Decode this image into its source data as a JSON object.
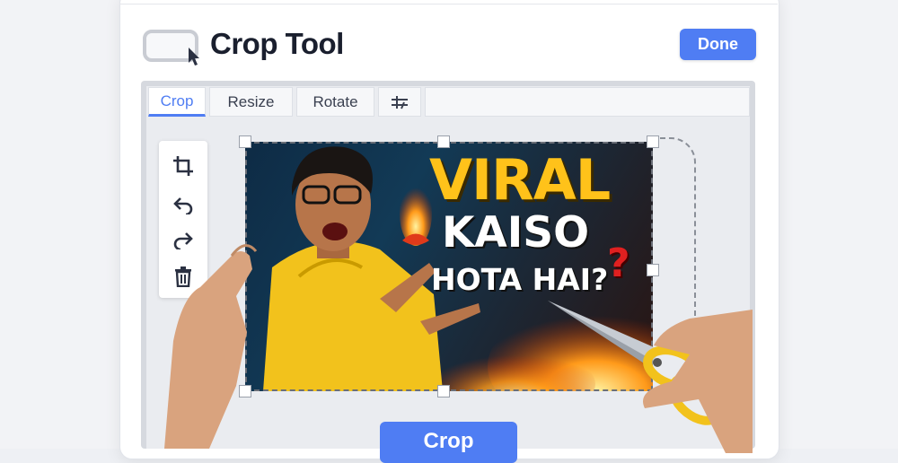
{
  "header": {
    "title": "Crop Tool",
    "done_label": "Done"
  },
  "tabs": [
    {
      "label": "Crop",
      "active": true
    },
    {
      "label": "Resize",
      "active": false
    },
    {
      "label": "Rotate",
      "active": false
    }
  ],
  "tools": [
    "crop-icon",
    "undo-icon",
    "redo-icon",
    "trash-icon"
  ],
  "thumbnail": {
    "line1": "VIRAL",
    "line2": "KAISO",
    "line3": "HOTA HAI?",
    "accent": "?"
  },
  "footer": {
    "crop_label": "Crop"
  },
  "colors": {
    "accent": "#4f7df3",
    "title_text": "#1a1f2e",
    "thumb_yellow": "#ffc21a",
    "thumb_red": "#e02020"
  }
}
